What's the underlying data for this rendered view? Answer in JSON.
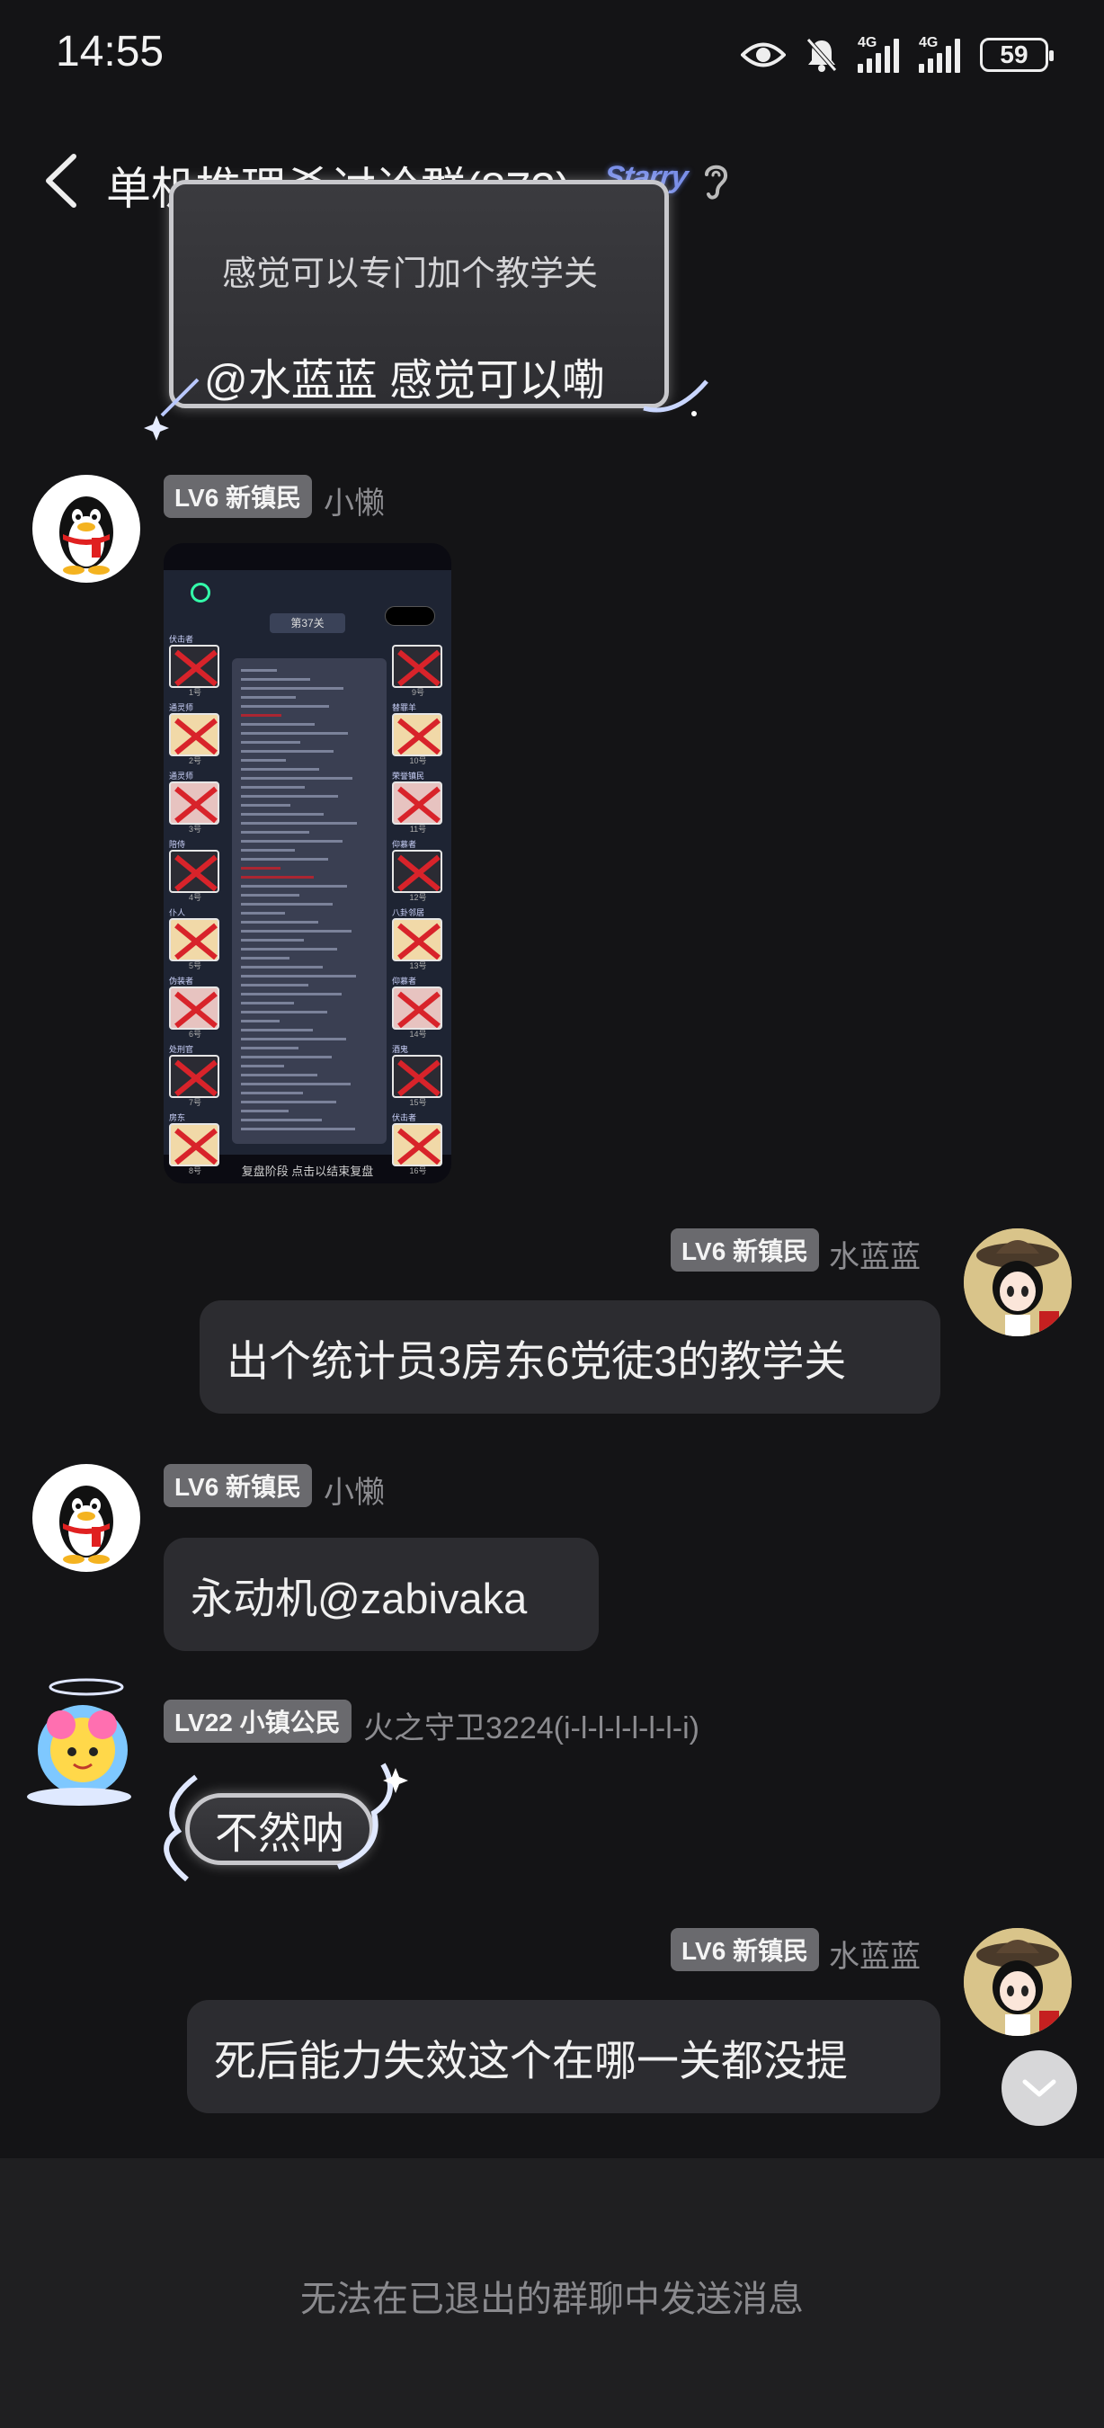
{
  "status_bar": {
    "time": "14:55",
    "icons": [
      "eye-icon",
      "bell-mute-icon",
      "signal-4g-icon",
      "signal-4g-icon"
    ],
    "network1": "4G",
    "network2": "4G",
    "battery": "59"
  },
  "header": {
    "title": "单机推理杀讨论群(873)",
    "badge": "Starry",
    "icons": [
      "back-icon",
      "ear-icon"
    ]
  },
  "messages": [
    {
      "quote_text": "感觉可以专门加个教学关",
      "reply_text": "@水蓝蓝 感觉可以嘞"
    },
    {
      "level": "LV6 新镇民",
      "nick": "小懒",
      "attachment": {
        "level_title": "第37关",
        "footer": "复盘阶段 点击以结束复盘",
        "roles_left": [
          "伏击者",
          "通灵师",
          "通灵师",
          "陪侍",
          "仆人",
          "伪装者",
          "处刑官",
          "房东"
        ],
        "nums_left": [
          "1号",
          "2号",
          "3号",
          "4号",
          "5号",
          "6号",
          "7号",
          "8号"
        ],
        "roles_right": [
          "",
          "替罪羊",
          "荣誉镇民",
          "仰慕者",
          "八卦邻居",
          "仰慕者",
          "酒鬼",
          "伏击者"
        ],
        "nums_right": [
          "9号",
          "10号",
          "11号",
          "12号",
          "13号",
          "14号",
          "15号",
          "16号"
        ]
      }
    },
    {
      "level": "LV6 新镇民",
      "nick": "水蓝蓝",
      "text": "出个统计员3房东6党徒3的教学关"
    },
    {
      "level": "LV6 新镇民",
      "nick": "小懒",
      "text": "永动机@zabivaka"
    },
    {
      "level": "LV22 小镇公民",
      "nick": "火之守卫3224(i-l-l-l-l-l-l-i)",
      "text": "不然呐"
    },
    {
      "level": "LV6 新镇民",
      "nick": "水蓝蓝",
      "text": "死后能力失效这个在哪一关都没提"
    }
  ],
  "footer": {
    "notice": "无法在已退出的群聊中发送消息"
  },
  "colors": {
    "background": "#141416",
    "bubble": "#2c2c30",
    "tag": "#6a6a6e",
    "footer": "#1f1f21",
    "accent_red": "#c8202a"
  }
}
